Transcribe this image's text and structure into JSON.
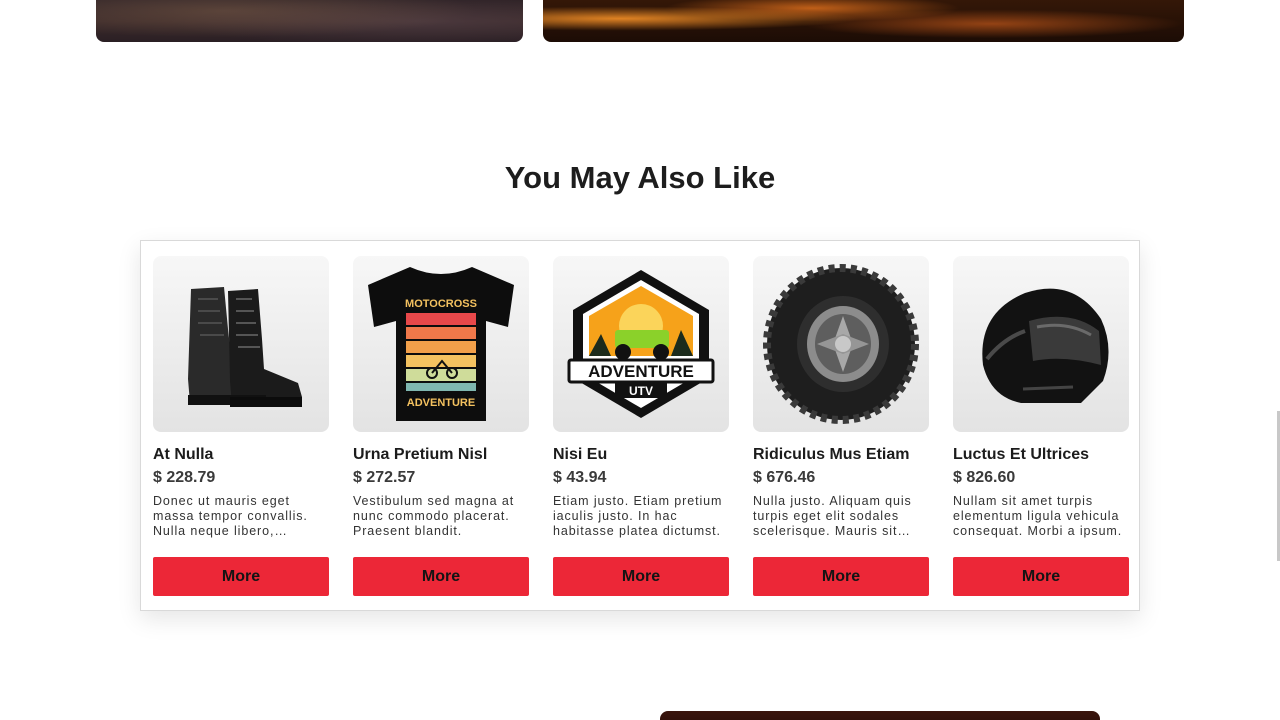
{
  "section": {
    "title": "You May Also Like"
  },
  "products": [
    {
      "name": "At Nulla",
      "price": "$ 228.79",
      "description": "Donec ut mauris eget massa tempor convallis. Nulla neque libero, convallis eget, eleifend luctus.",
      "button": "More",
      "image_icon": "boots-icon"
    },
    {
      "name": "Urna Pretium Nisl",
      "price": "$ 272.57",
      "description": "Vestibulum sed magna at nunc commodo placerat. Praesent blandit.",
      "button": "More",
      "image_icon": "tshirt-icon",
      "image_text": {
        "top": "MOTOCROSS",
        "bottom": "ADVENTURE"
      }
    },
    {
      "name": "Nisi Eu",
      "price": "$ 43.94",
      "description": "Etiam justo. Etiam pretium iaculis justo. In hac habitasse platea dictumst.",
      "button": "More",
      "image_icon": "utv-badge-icon",
      "image_text": {
        "main": "ADVENTURE",
        "sub": "UTV"
      }
    },
    {
      "name": "Ridiculus Mus Etiam",
      "price": "$ 676.46",
      "description": "Nulla justo. Aliquam quis turpis eget elit sodales scelerisque. Mauris sit amet eros.",
      "button": "More",
      "image_icon": "tire-icon"
    },
    {
      "name": "Luctus Et Ultrices",
      "price": "$ 826.60",
      "description": "Nullam sit amet turpis elementum ligula vehicula consequat. Morbi a ipsum.",
      "button": "More",
      "image_icon": "helmet-icon"
    }
  ],
  "colors": {
    "button": "#ec2737",
    "title": "#1d1d1d"
  }
}
